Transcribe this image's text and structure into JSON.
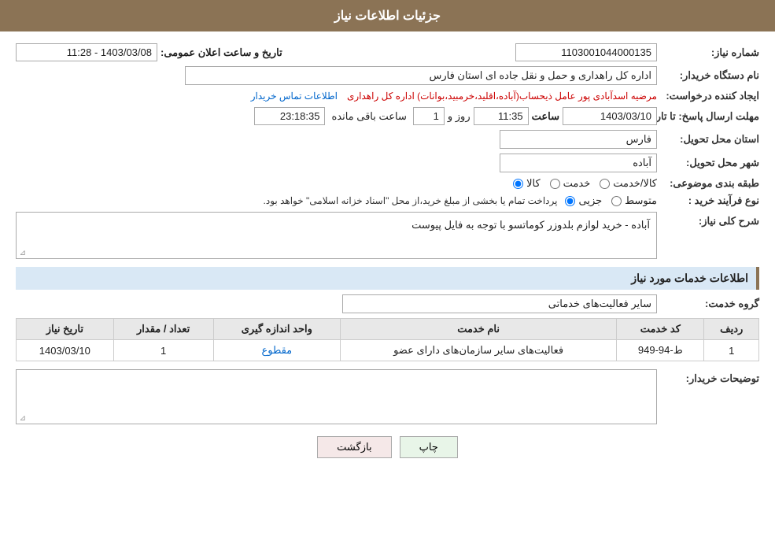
{
  "header": {
    "title": "جزئیات اطلاعات نیاز"
  },
  "fields": {
    "need_number_label": "شماره نیاز:",
    "need_number_value": "1103001044000135",
    "date_label": "تاریخ و ساعت اعلان عمومی:",
    "date_value": "1403/03/08 - 11:28",
    "buyer_org_label": "نام دستگاه خریدار:",
    "buyer_org_value": "اداره کل راهداری و حمل و نقل جاده ای استان فارس",
    "requester_label": "ایجاد کننده درخواست:",
    "requester_value": "مرضیه اسدآبادی پور عامل ذیحساب(آباده،اقلید،خرمبید،بوانات) اداره کل راهداری",
    "contact_link": "اطلاعات تماس خریدار",
    "reply_deadline_label": "مهلت ارسال پاسخ: تا تاریخ:",
    "reply_date": "1403/03/10",
    "reply_time_label": "ساعت",
    "reply_time": "11:35",
    "reply_days_label": "روز و",
    "reply_days": "1",
    "reply_remaining_label": "ساعت باقی مانده",
    "reply_remaining": "23:18:35",
    "province_label": "استان محل تحویل:",
    "province_value": "فارس",
    "city_label": "شهر محل تحویل:",
    "city_value": "آباده",
    "category_label": "طبقه بندی موضوعی:",
    "category_options": [
      "کالا",
      "خدمت",
      "کالا/خدمت"
    ],
    "category_selected": "کالا",
    "purchase_type_label": "نوع فرآیند خرید :",
    "purchase_type_options": [
      "جزیی",
      "متوسط"
    ],
    "purchase_type_note": "پرداخت تمام یا بخشی از مبلغ خرید،از محل \"اسناد خزانه اسلامی\" خواهد بود.",
    "need_description_label": "شرح کلی نیاز:",
    "need_description_value": "آباده - خرید لوازم بلدوزر کوماتسو با توجه به فایل پیوست",
    "services_section_label": "اطلاعات خدمات مورد نیاز",
    "service_group_label": "گروه خدمت:",
    "service_group_value": "سایر فعالیت‌های خدماتی",
    "table": {
      "headers": [
        "ردیف",
        "کد خدمت",
        "نام خدمت",
        "واحد اندازه گیری",
        "تعداد / مقدار",
        "تاریخ نیاز"
      ],
      "rows": [
        {
          "row": "1",
          "code": "ط-94-949",
          "name": "فعالیت‌های سایر سازمان‌های دارای عضو",
          "unit": "مقطوع",
          "quantity": "1",
          "date": "1403/03/10"
        }
      ]
    },
    "buyer_description_label": "توضیحات خریدار:",
    "buyer_description_value": ""
  },
  "buttons": {
    "back_label": "بازگشت",
    "print_label": "چاپ"
  }
}
